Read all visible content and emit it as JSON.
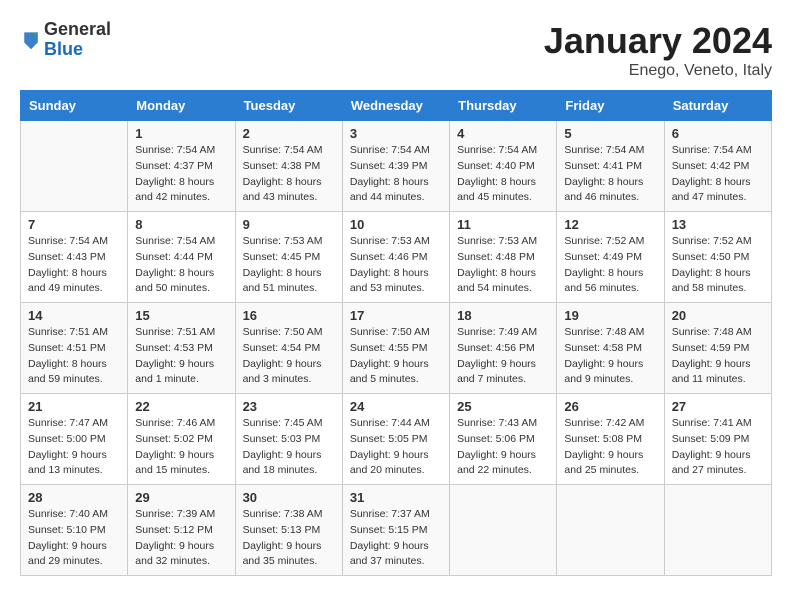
{
  "header": {
    "logo_general": "General",
    "logo_blue": "Blue",
    "month_title": "January 2024",
    "subtitle": "Enego, Veneto, Italy"
  },
  "weekdays": [
    "Sunday",
    "Monday",
    "Tuesday",
    "Wednesday",
    "Thursday",
    "Friday",
    "Saturday"
  ],
  "weeks": [
    [
      {
        "day": "",
        "sunrise": "",
        "sunset": "",
        "daylight": ""
      },
      {
        "day": "1",
        "sunrise": "Sunrise: 7:54 AM",
        "sunset": "Sunset: 4:37 PM",
        "daylight": "Daylight: 8 hours and 42 minutes."
      },
      {
        "day": "2",
        "sunrise": "Sunrise: 7:54 AM",
        "sunset": "Sunset: 4:38 PM",
        "daylight": "Daylight: 8 hours and 43 minutes."
      },
      {
        "day": "3",
        "sunrise": "Sunrise: 7:54 AM",
        "sunset": "Sunset: 4:39 PM",
        "daylight": "Daylight: 8 hours and 44 minutes."
      },
      {
        "day": "4",
        "sunrise": "Sunrise: 7:54 AM",
        "sunset": "Sunset: 4:40 PM",
        "daylight": "Daylight: 8 hours and 45 minutes."
      },
      {
        "day": "5",
        "sunrise": "Sunrise: 7:54 AM",
        "sunset": "Sunset: 4:41 PM",
        "daylight": "Daylight: 8 hours and 46 minutes."
      },
      {
        "day": "6",
        "sunrise": "Sunrise: 7:54 AM",
        "sunset": "Sunset: 4:42 PM",
        "daylight": "Daylight: 8 hours and 47 minutes."
      }
    ],
    [
      {
        "day": "7",
        "sunrise": "Sunrise: 7:54 AM",
        "sunset": "Sunset: 4:43 PM",
        "daylight": "Daylight: 8 hours and 49 minutes."
      },
      {
        "day": "8",
        "sunrise": "Sunrise: 7:54 AM",
        "sunset": "Sunset: 4:44 PM",
        "daylight": "Daylight: 8 hours and 50 minutes."
      },
      {
        "day": "9",
        "sunrise": "Sunrise: 7:53 AM",
        "sunset": "Sunset: 4:45 PM",
        "daylight": "Daylight: 8 hours and 51 minutes."
      },
      {
        "day": "10",
        "sunrise": "Sunrise: 7:53 AM",
        "sunset": "Sunset: 4:46 PM",
        "daylight": "Daylight: 8 hours and 53 minutes."
      },
      {
        "day": "11",
        "sunrise": "Sunrise: 7:53 AM",
        "sunset": "Sunset: 4:48 PM",
        "daylight": "Daylight: 8 hours and 54 minutes."
      },
      {
        "day": "12",
        "sunrise": "Sunrise: 7:52 AM",
        "sunset": "Sunset: 4:49 PM",
        "daylight": "Daylight: 8 hours and 56 minutes."
      },
      {
        "day": "13",
        "sunrise": "Sunrise: 7:52 AM",
        "sunset": "Sunset: 4:50 PM",
        "daylight": "Daylight: 8 hours and 58 minutes."
      }
    ],
    [
      {
        "day": "14",
        "sunrise": "Sunrise: 7:51 AM",
        "sunset": "Sunset: 4:51 PM",
        "daylight": "Daylight: 8 hours and 59 minutes."
      },
      {
        "day": "15",
        "sunrise": "Sunrise: 7:51 AM",
        "sunset": "Sunset: 4:53 PM",
        "daylight": "Daylight: 9 hours and 1 minute."
      },
      {
        "day": "16",
        "sunrise": "Sunrise: 7:50 AM",
        "sunset": "Sunset: 4:54 PM",
        "daylight": "Daylight: 9 hours and 3 minutes."
      },
      {
        "day": "17",
        "sunrise": "Sunrise: 7:50 AM",
        "sunset": "Sunset: 4:55 PM",
        "daylight": "Daylight: 9 hours and 5 minutes."
      },
      {
        "day": "18",
        "sunrise": "Sunrise: 7:49 AM",
        "sunset": "Sunset: 4:56 PM",
        "daylight": "Daylight: 9 hours and 7 minutes."
      },
      {
        "day": "19",
        "sunrise": "Sunrise: 7:48 AM",
        "sunset": "Sunset: 4:58 PM",
        "daylight": "Daylight: 9 hours and 9 minutes."
      },
      {
        "day": "20",
        "sunrise": "Sunrise: 7:48 AM",
        "sunset": "Sunset: 4:59 PM",
        "daylight": "Daylight: 9 hours and 11 minutes."
      }
    ],
    [
      {
        "day": "21",
        "sunrise": "Sunrise: 7:47 AM",
        "sunset": "Sunset: 5:00 PM",
        "daylight": "Daylight: 9 hours and 13 minutes."
      },
      {
        "day": "22",
        "sunrise": "Sunrise: 7:46 AM",
        "sunset": "Sunset: 5:02 PM",
        "daylight": "Daylight: 9 hours and 15 minutes."
      },
      {
        "day": "23",
        "sunrise": "Sunrise: 7:45 AM",
        "sunset": "Sunset: 5:03 PM",
        "daylight": "Daylight: 9 hours and 18 minutes."
      },
      {
        "day": "24",
        "sunrise": "Sunrise: 7:44 AM",
        "sunset": "Sunset: 5:05 PM",
        "daylight": "Daylight: 9 hours and 20 minutes."
      },
      {
        "day": "25",
        "sunrise": "Sunrise: 7:43 AM",
        "sunset": "Sunset: 5:06 PM",
        "daylight": "Daylight: 9 hours and 22 minutes."
      },
      {
        "day": "26",
        "sunrise": "Sunrise: 7:42 AM",
        "sunset": "Sunset: 5:08 PM",
        "daylight": "Daylight: 9 hours and 25 minutes."
      },
      {
        "day": "27",
        "sunrise": "Sunrise: 7:41 AM",
        "sunset": "Sunset: 5:09 PM",
        "daylight": "Daylight: 9 hours and 27 minutes."
      }
    ],
    [
      {
        "day": "28",
        "sunrise": "Sunrise: 7:40 AM",
        "sunset": "Sunset: 5:10 PM",
        "daylight": "Daylight: 9 hours and 29 minutes."
      },
      {
        "day": "29",
        "sunrise": "Sunrise: 7:39 AM",
        "sunset": "Sunset: 5:12 PM",
        "daylight": "Daylight: 9 hours and 32 minutes."
      },
      {
        "day": "30",
        "sunrise": "Sunrise: 7:38 AM",
        "sunset": "Sunset: 5:13 PM",
        "daylight": "Daylight: 9 hours and 35 minutes."
      },
      {
        "day": "31",
        "sunrise": "Sunrise: 7:37 AM",
        "sunset": "Sunset: 5:15 PM",
        "daylight": "Daylight: 9 hours and 37 minutes."
      },
      {
        "day": "",
        "sunrise": "",
        "sunset": "",
        "daylight": ""
      },
      {
        "day": "",
        "sunrise": "",
        "sunset": "",
        "daylight": ""
      },
      {
        "day": "",
        "sunrise": "",
        "sunset": "",
        "daylight": ""
      }
    ]
  ]
}
